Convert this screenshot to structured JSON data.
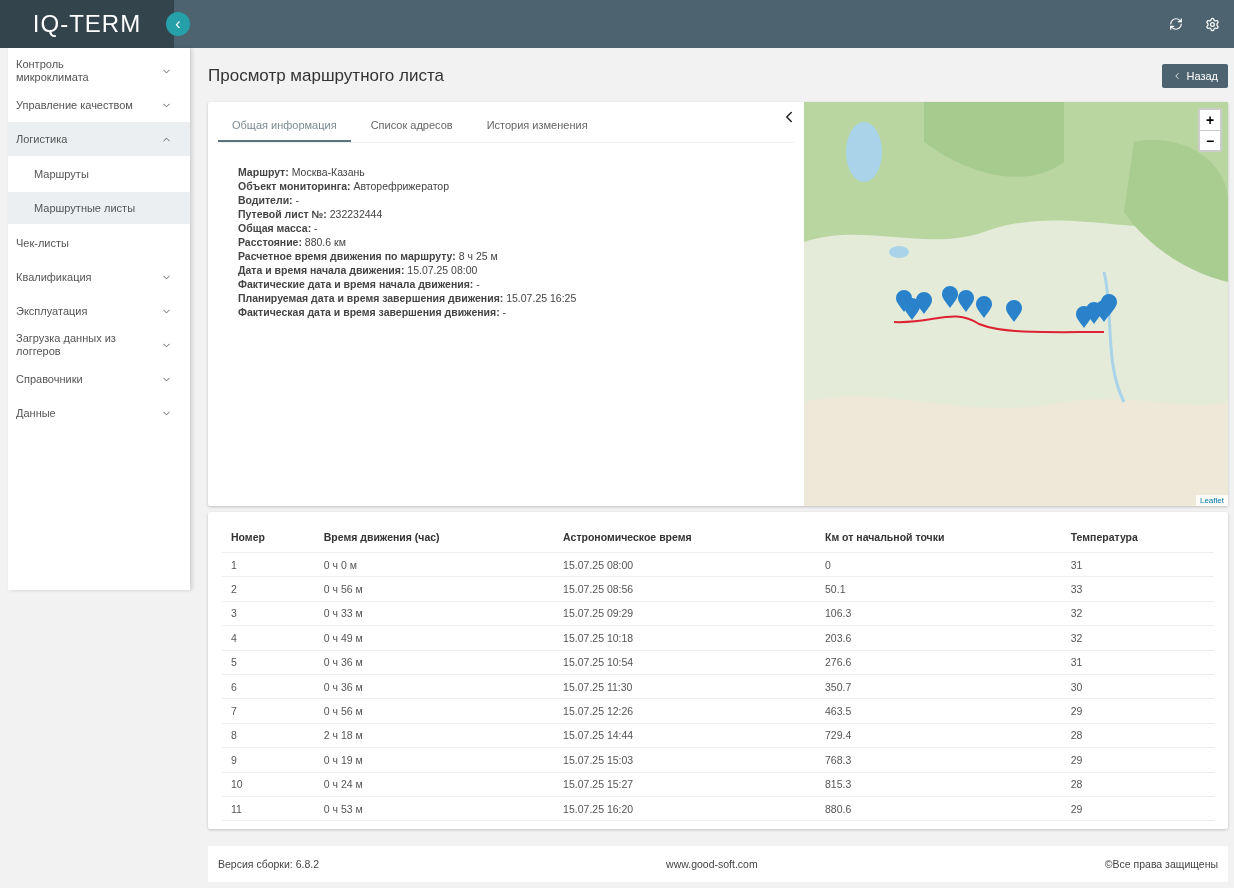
{
  "header": {
    "logo": "IQ-TERM",
    "collapse_icon": "‹"
  },
  "sidebar": {
    "items": [
      {
        "label": "Контроль микроклимата",
        "expandable": true,
        "expanded": false,
        "selected": false
      },
      {
        "label": "Управление качеством",
        "expandable": true,
        "expanded": false,
        "selected": false
      },
      {
        "label": "Логистика",
        "expandable": true,
        "expanded": true,
        "selected": true,
        "children": [
          {
            "label": "Маршруты",
            "selected": false
          },
          {
            "label": "Маршрутные листы",
            "selected": true
          }
        ]
      },
      {
        "label": "Чек-листы",
        "expandable": false,
        "expanded": false,
        "selected": false
      },
      {
        "label": "Квалификация",
        "expandable": true,
        "expanded": false,
        "selected": false
      },
      {
        "label": "Эксплуатация",
        "expandable": true,
        "expanded": false,
        "selected": false
      },
      {
        "label": "Загрузка данных из логгеров",
        "expandable": true,
        "expanded": false,
        "selected": false
      },
      {
        "label": "Справочники",
        "expandable": true,
        "expanded": false,
        "selected": false
      },
      {
        "label": "Данные",
        "expandable": true,
        "expanded": false,
        "selected": false
      }
    ]
  },
  "page": {
    "title": "Просмотр маршрутного листа",
    "back_button": "Назад"
  },
  "tabs": [
    {
      "label": "Общая информация",
      "selected": true
    },
    {
      "label": "Список адресов",
      "selected": false
    },
    {
      "label": "История изменения",
      "selected": false
    }
  ],
  "info": [
    "**Маршрут:** Москва-Казань",
    "**Объект мониторинга:** Авторефрижератор",
    "**Водители:** -",
    "**Путевой лист №:** 232232444",
    "**Общая масса:** -",
    "**Расстояние:** 880.6 км",
    "**Расчетное время движения по маршруту:** 8 ч 25 м",
    "**Дата и время начала движения:** 15.07.25 08:00",
    "**Фактические дата и время начала движения:** -",
    "**Планируемая дата и время завершения движения:** 15.07.25 16:25",
    "**Фактическая дата и время завершения движения:** -"
  ],
  "map": {
    "zoom_in": "+",
    "zoom_out": "−",
    "attribution": "Leaflet"
  },
  "table": {
    "columns": [
      "Номер",
      "Время движения (час)",
      "Астрономическое время",
      "Км от начальной точки",
      "Температура"
    ],
    "rows": [
      [
        "1",
        "0 ч 0 м",
        "15.07.25 08:00",
        "0",
        "31"
      ],
      [
        "2",
        "0 ч 56 м",
        "15.07.25 08:56",
        "50.1",
        "33"
      ],
      [
        "3",
        "0 ч 33 м",
        "15.07.25 09:29",
        "106.3",
        "32"
      ],
      [
        "4",
        "0 ч 49 м",
        "15.07.25 10:18",
        "203.6",
        "32"
      ],
      [
        "5",
        "0 ч 36 м",
        "15.07.25 10:54",
        "276.6",
        "31"
      ],
      [
        "6",
        "0 ч 36 м",
        "15.07.25 11:30",
        "350.7",
        "30"
      ],
      [
        "7",
        "0 ч 56 м",
        "15.07.25 12:26",
        "463.5",
        "29"
      ],
      [
        "8",
        "2 ч 18 м",
        "15.07.25 14:44",
        "729.4",
        "28"
      ],
      [
        "9",
        "0 ч 19 м",
        "15.07.25 15:03",
        "768.3",
        "29"
      ],
      [
        "10",
        "0 ч 24 м",
        "15.07.25 15:27",
        "815.3",
        "28"
      ],
      [
        "11",
        "0 ч 53 м",
        "15.07.25 16:20",
        "880.6",
        "29"
      ]
    ]
  },
  "footer": {
    "version": "Версия сборки: 6.8.2",
    "site": "www.good-soft.com",
    "rights": "©Все права защищены"
  }
}
